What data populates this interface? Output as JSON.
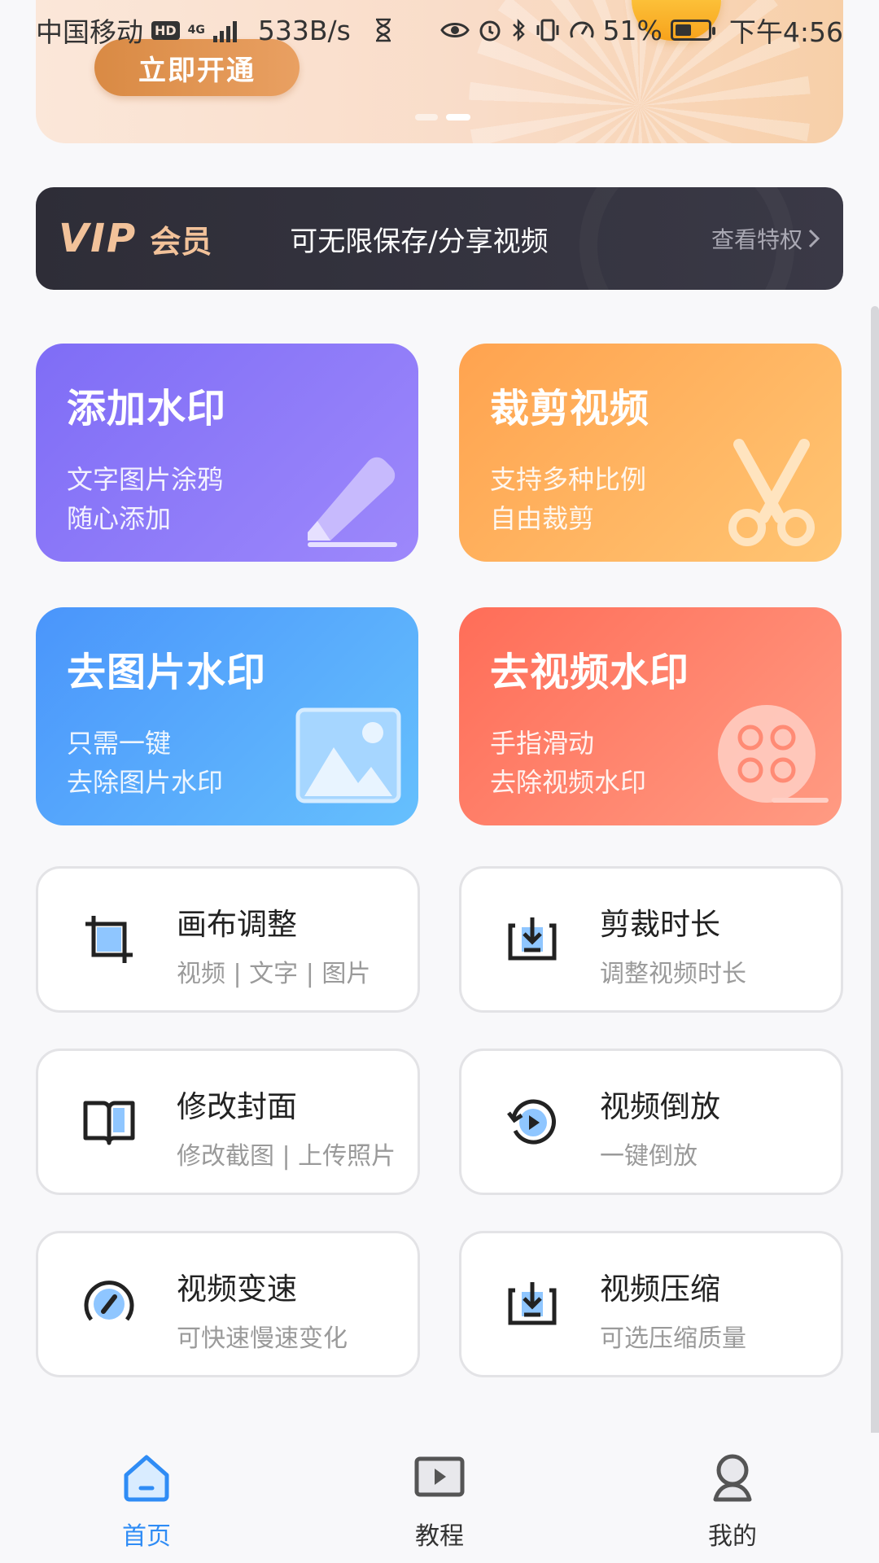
{
  "status_bar": {
    "carrier": "中国移动",
    "hd": "HD",
    "network": "4G",
    "speed": "533B/s",
    "battery": "51%",
    "battery_level": 0.51,
    "time": "下午4:56"
  },
  "banner": {
    "cta_label": "立即开通",
    "page_count": 2,
    "active_page": 2
  },
  "vip": {
    "logo": "VIP",
    "member": "会员",
    "description": "可无限保存/分享视频",
    "link": "查看特权"
  },
  "feature_cards": [
    {
      "title": "添加水印",
      "line1": "文字图片涂鸦",
      "line2": "随心添加",
      "icon": "pencil-icon"
    },
    {
      "title": "裁剪视频",
      "line1": "支持多种比例",
      "line2": "自由裁剪",
      "icon": "scissors-icon"
    },
    {
      "title": "去图片水印",
      "line1": "只需一键",
      "line2": "去除图片水印",
      "icon": "image-icon"
    },
    {
      "title": "去视频水印",
      "line1": "手指滑动",
      "line2": "去除视频水印",
      "icon": "film-reel-icon"
    }
  ],
  "tools": [
    {
      "title": "画布调整",
      "subtitle": "视频 | 文字 | 图片",
      "icon": "crop-icon"
    },
    {
      "title": "剪裁时长",
      "subtitle": "调整视频时长",
      "icon": "trim-icon"
    },
    {
      "title": "修改封面",
      "subtitle": "修改截图 | 上传照片",
      "icon": "book-icon"
    },
    {
      "title": "视频倒放",
      "subtitle": "一键倒放",
      "icon": "reverse-play-icon"
    },
    {
      "title": "视频变速",
      "subtitle": "可快速慢速变化",
      "icon": "speedometer-icon"
    },
    {
      "title": "视频压缩",
      "subtitle": "可选压缩质量",
      "icon": "compress-icon"
    }
  ],
  "bottom_nav": [
    {
      "label": "首页",
      "icon": "home-icon",
      "active": true
    },
    {
      "label": "教程",
      "icon": "play-icon",
      "active": false
    },
    {
      "label": "我的",
      "icon": "user-icon",
      "active": false
    }
  ],
  "colors": {
    "accent": "#2f8cf5",
    "vip_gold": "#f2c29a",
    "icon_light_blue": "#8fc6ff"
  }
}
